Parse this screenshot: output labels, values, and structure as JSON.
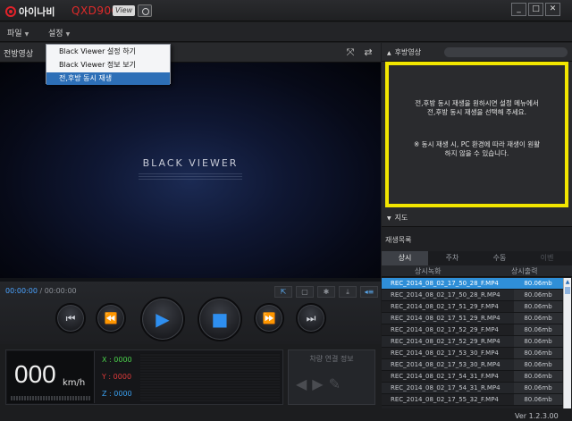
{
  "app": {
    "brand": "아이나비",
    "model": "QXD900",
    "view_badge": "View",
    "version": "Ver 1.2.3.00"
  },
  "window_buttons": [
    "_",
    "□",
    "✕"
  ],
  "menu": {
    "file": "파일",
    "settings": "설정",
    "dropdown": [
      "Black Viewer 설정 하기",
      "Black Viewer 정보 보기",
      "전,후방 동시 재생"
    ]
  },
  "front": {
    "title": "전방영상",
    "video_brand": "BLACK VIEWER",
    "current_time": "00:00:00",
    "separator": " / ",
    "total_time": "00:00:00",
    "progress_fraction": 0.0
  },
  "playback_buttons": [
    "prev-file",
    "rewind",
    "play",
    "stop",
    "fast-forward",
    "next-file"
  ],
  "speed": {
    "value": "000",
    "unit": "km/h"
  },
  "gsensor": {
    "x": "X : 0000",
    "y": "Y : 0000",
    "z": "Z : 0000",
    "colors": {
      "x": "#4bd24b",
      "y": "#e03a3a",
      "z": "#3aa0f0"
    }
  },
  "vehicle_link": {
    "title": "차량 연결 정보"
  },
  "rear": {
    "title": "후방영상",
    "notice_line1": "전,후방 동시 재생을 원하시면 설정 메뉴에서",
    "notice_line2": "전,후방 동시 재생을 선택해 주세요.",
    "notice_line3": "※ 동시 재생 시, PC 환경에 따라 재생이 원활",
    "notice_line4": "하지 않을 수 있습니다."
  },
  "map": {
    "title": "지도"
  },
  "playlist": {
    "title": "재생목록",
    "tabs": [
      "상시",
      "주차",
      "수동",
      "이벤"
    ],
    "active_tab": 0,
    "subtabs": [
      "상시녹화",
      "상시출력"
    ],
    "files": [
      {
        "name": "REC_2014_08_02_17_50_28_F.MP4",
        "size": "80.06mb"
      },
      {
        "name": "REC_2014_08_02_17_50_28_R.MP4",
        "size": "80.06mb"
      },
      {
        "name": "REC_2014_08_02_17_51_29_F.MP4",
        "size": "80.06mb"
      },
      {
        "name": "REC_2014_08_02_17_51_29_R.MP4",
        "size": "80.06mb"
      },
      {
        "name": "REC_2014_08_02_17_52_29_F.MP4",
        "size": "80.06mb"
      },
      {
        "name": "REC_2014_08_02_17_52_29_R.MP4",
        "size": "80.06mb"
      },
      {
        "name": "REC_2014_08_02_17_53_30_F.MP4",
        "size": "80.06mb"
      },
      {
        "name": "REC_2014_08_02_17_53_30_R.MP4",
        "size": "80.06mb"
      },
      {
        "name": "REC_2014_08_02_17_54_31_F.MP4",
        "size": "80.06mb"
      },
      {
        "name": "REC_2014_08_02_17_54_31_R.MP4",
        "size": "80.06mb"
      },
      {
        "name": "REC_2014_08_02_17_55_32_F.MP4",
        "size": "80.06mb"
      }
    ],
    "selected_index": 0
  },
  "colors": {
    "accent": "#2f8fd8",
    "notice_border": "#f2e600",
    "brand_red": "#e2222a"
  }
}
